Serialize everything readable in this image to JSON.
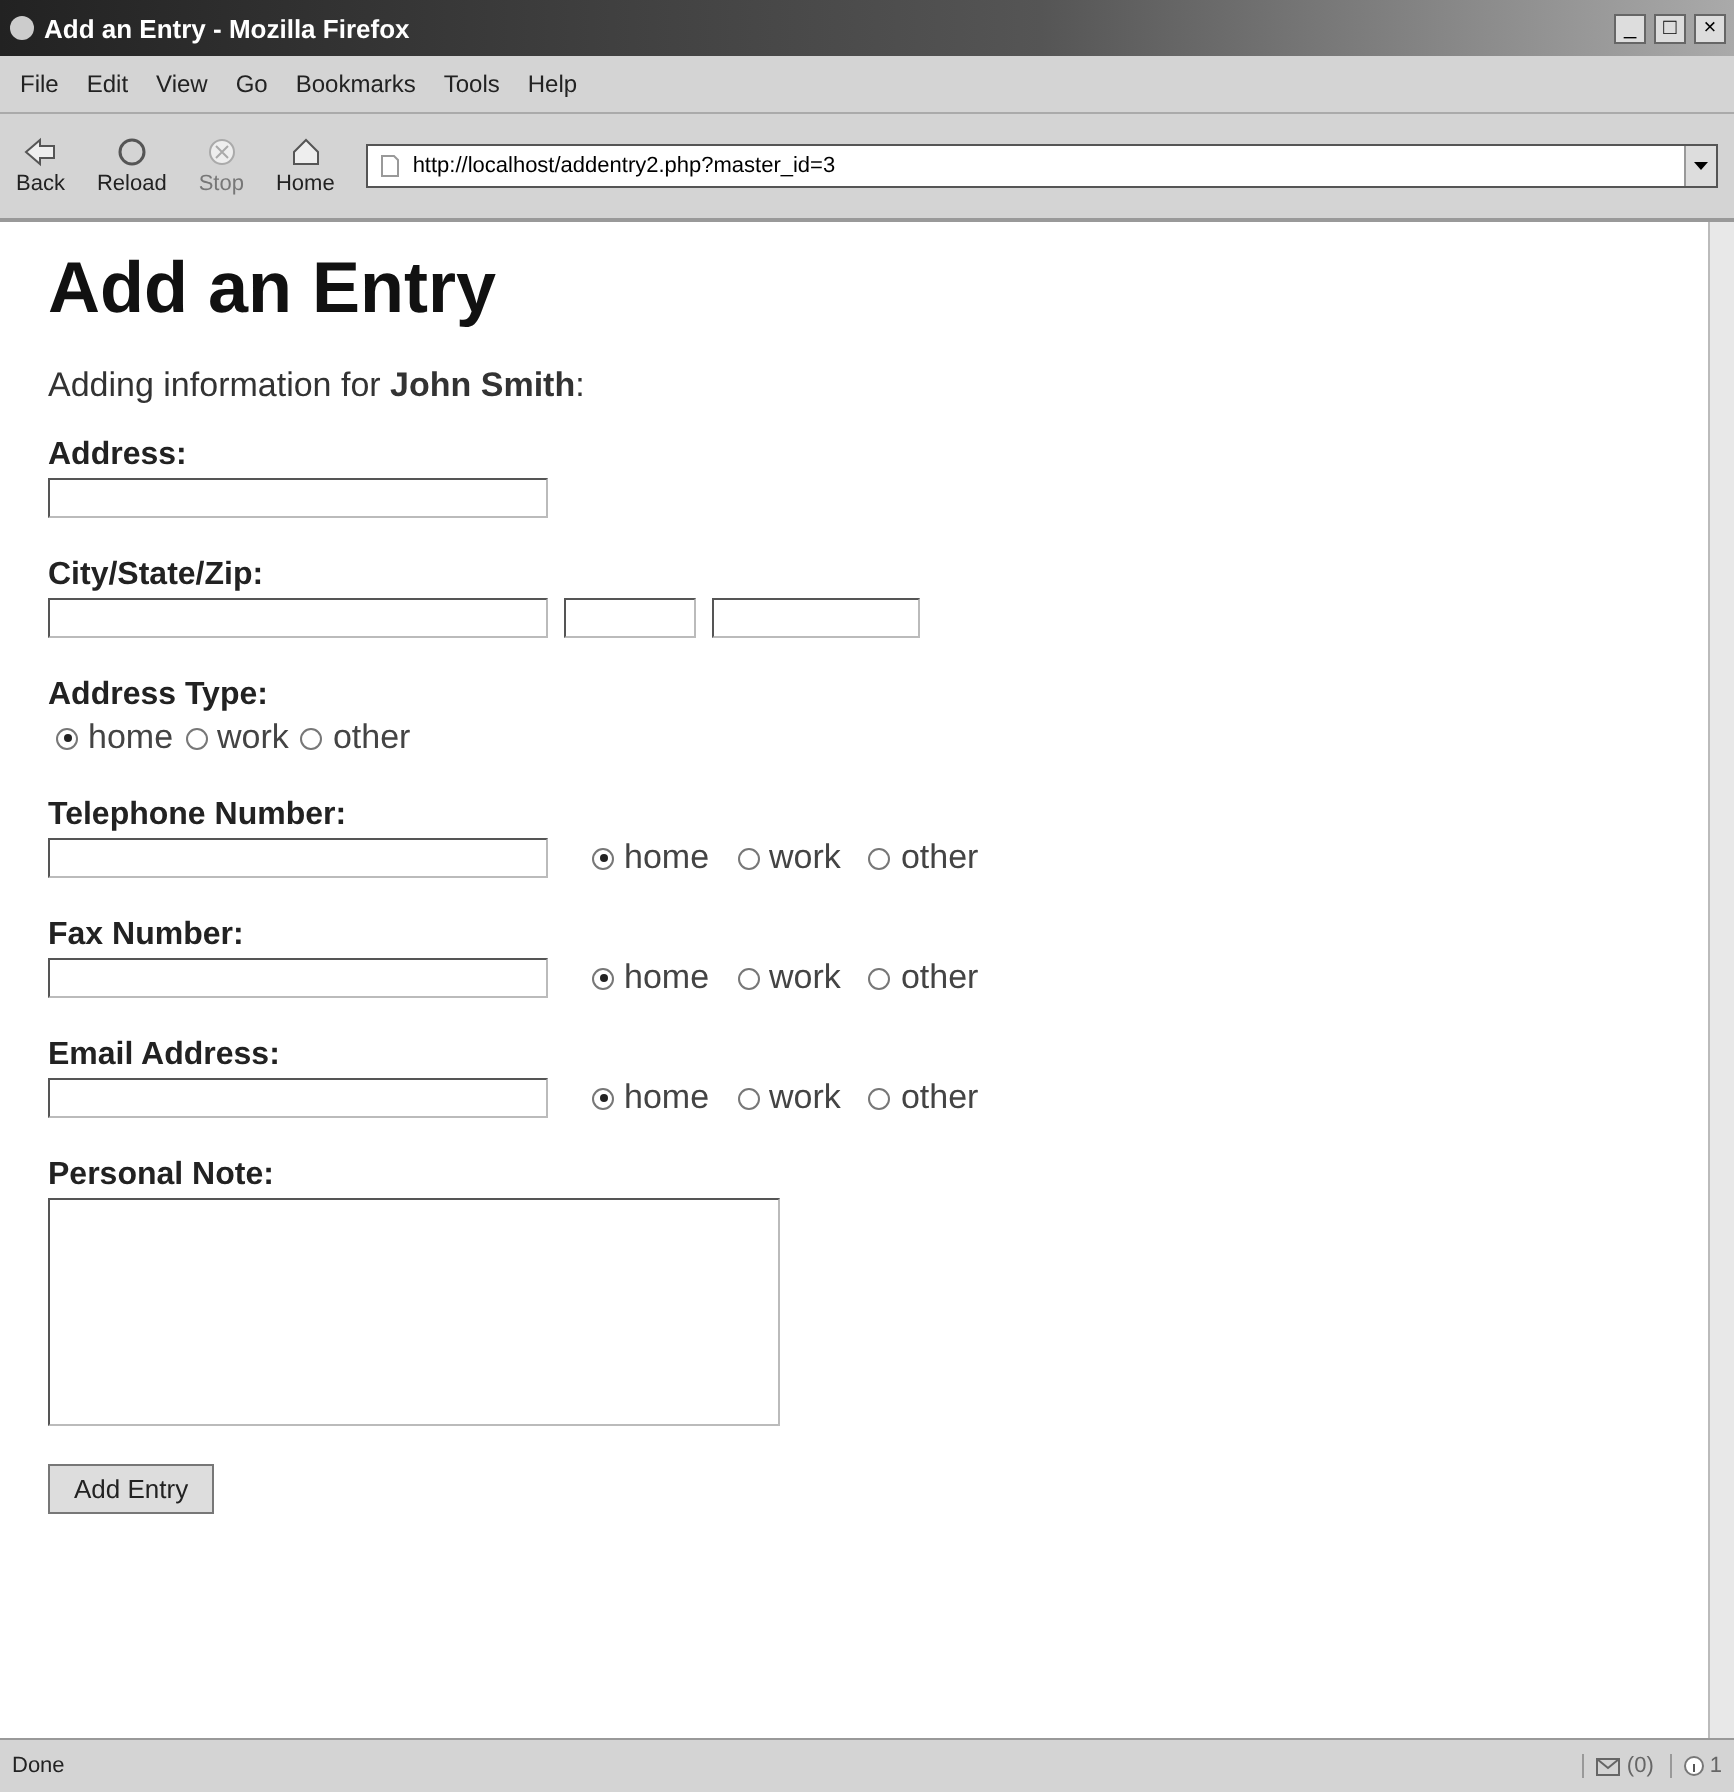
{
  "window": {
    "title": "Add an Entry - Mozilla Firefox",
    "controls": [
      "_",
      "□",
      "×"
    ]
  },
  "menu": [
    "File",
    "Edit",
    "View",
    "Go",
    "Bookmarks",
    "Tools",
    "Help"
  ],
  "toolbar": [
    {
      "label": "Back",
      "disabled": false,
      "kind": "back"
    },
    {
      "label": "Reload",
      "disabled": false,
      "kind": "reload"
    },
    {
      "label": "Stop",
      "disabled": true,
      "kind": "stop"
    },
    {
      "label": "Home",
      "disabled": false,
      "kind": "home"
    }
  ],
  "address_bar": {
    "value": "http://localhost/addentry2.php?master_id=3"
  },
  "page": {
    "heading": "Add an Entry",
    "intro": "Adding information for **John Smith**:",
    "fields": [
      {
        "kind": "text",
        "label": "Address:"
      },
      {
        "kind": "cityzip",
        "label": "City/State/Zip:"
      },
      {
        "kind": "radios",
        "label": "Address Type:",
        "options": [
          {
            "label": "home",
            "selected": true
          },
          {
            "label": "work",
            "selected": false
          },
          {
            "label": "other",
            "selected": false
          }
        ]
      },
      {
        "kind": "textradios",
        "label": "Telephone Number:",
        "options": [
          {
            "label": "home",
            "selected": true
          },
          {
            "label": "work",
            "selected": false
          },
          {
            "label": "other",
            "selected": false
          }
        ]
      },
      {
        "kind": "textradios",
        "label": "Fax Number:",
        "options": [
          {
            "label": "home",
            "selected": true
          },
          {
            "label": "work",
            "selected": false
          },
          {
            "label": "other",
            "selected": false
          }
        ]
      },
      {
        "kind": "textradios",
        "label": "Email Address:",
        "options": [
          {
            "label": "home",
            "selected": true
          },
          {
            "label": "work",
            "selected": false
          },
          {
            "label": "other",
            "selected": false
          }
        ]
      },
      {
        "kind": "textarea",
        "label": "Personal Note:"
      }
    ],
    "submit": "Add Entry"
  },
  "status_bar": {
    "text": "Done",
    "mail": "(0)",
    "info": "1"
  }
}
